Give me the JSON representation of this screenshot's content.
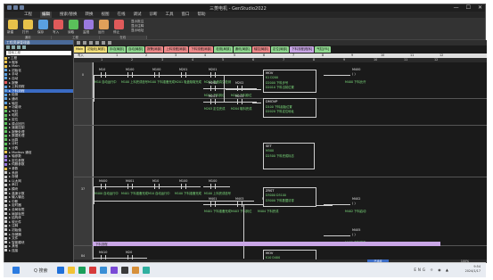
{
  "window": {
    "title": "三菱电机 - GenStudio2022",
    "controls": [
      "—",
      "☐",
      "✕"
    ]
  },
  "menu": {
    "items": [
      "工程",
      "编辑",
      "搜索/替换",
      "转换",
      "视图",
      "在线",
      "调试",
      "诊断",
      "工具",
      "窗口",
      "帮助"
    ],
    "active": 1
  },
  "ribbon": {
    "buttons": [
      {
        "label": "新建",
        "color": "#e8c24a"
      },
      {
        "label": "打开",
        "color": "#e8c24a"
      },
      {
        "label": "保存",
        "color": "#5aa0e0"
      },
      {
        "label": "写入",
        "color": "#e05a5a"
      },
      {
        "label": "读取",
        "color": "#5ac05a"
      },
      {
        "label": "监视",
        "color": "#9a7ae0"
      },
      {
        "label": "运行",
        "color": "#e0a05a"
      },
      {
        "label": "停止",
        "color": "#e05a5a"
      }
    ],
    "side_options": [
      "显示批注",
      "显示注释",
      "显示地址"
    ],
    "groups": [
      "通用",
      "工程",
      "在线"
    ]
  },
  "sidebar": {
    "title": "工程资源管理器",
    "search_placeholder": "搜索工程",
    "items": [
      {
        "label": "▾ 工程",
        "color": "#e8c24a",
        "selected": false
      },
      {
        "label": "  ▾ 程序",
        "color": "#e8c24a",
        "selected": false
      },
      {
        "label": "    ▸ Main",
        "color": "#e8c24a",
        "selected": false
      },
      {
        "label": "    ▸ 初始化",
        "color": "#5aa0e0",
        "selected": false
      },
      {
        "label": "    ▸ 手动",
        "color": "#5aa0e0",
        "selected": false
      },
      {
        "label": "    ▸ 自动",
        "color": "#5aa0e0",
        "selected": false
      },
      {
        "label": "    ▸ 报警",
        "color": "#e05a5a",
        "selected": false
      },
      {
        "label": "    ▸ 上料流程",
        "color": "#5aa0e0",
        "selected": false
      },
      {
        "label": "    ▸ 下料流程",
        "color": "#5aa0e0",
        "selected": true
      },
      {
        "label": "    ▸ 检测",
        "color": "#5aa0e0",
        "selected": false
      },
      {
        "label": "    ▸ 通讯",
        "color": "#5aa0e0",
        "selected": false
      },
      {
        "label": "    ▸ 轴控",
        "color": "#5aa0e0",
        "selected": false
      },
      {
        "label": "  ▾ 功能块",
        "color": "#e8c24a",
        "selected": false
      },
      {
        "label": "    ▸ 气缸",
        "color": "#5ac05a",
        "selected": false
      },
      {
        "label": "    ▸ 电机",
        "color": "#5ac05a",
        "selected": false
      },
      {
        "label": "    ▸ 定位",
        "color": "#5ac05a",
        "selected": false
      },
      {
        "label": "    ▸ 原点回归",
        "color": "#5ac05a",
        "selected": false
      },
      {
        "label": "    ▸ 速度控制",
        "color": "#5ac05a",
        "selected": false
      },
      {
        "label": "    ▸ 报警处理",
        "color": "#5ac05a",
        "selected": false
      },
      {
        "label": "    ▸ 数据处理",
        "color": "#5ac05a",
        "selected": false
      },
      {
        "label": "    ▸ 运算",
        "color": "#5ac05a",
        "selected": false
      },
      {
        "label": "    ▸ 计时",
        "color": "#5ac05a",
        "selected": false
      },
      {
        "label": "    ▸ 计数",
        "color": "#5ac05a",
        "selected": false
      },
      {
        "label": "  ▸ Modbus 通信",
        "color": "#e8c24a",
        "selected": false
      },
      {
        "label": "    ▸ 轴参数",
        "color": "#9a7ae0",
        "selected": false
      },
      {
        "label": "    ▸ 定位参数",
        "color": "#9a7ae0",
        "selected": false
      },
      {
        "label": "    ▸ 伺服参数",
        "color": "#9a7ae0",
        "selected": false
      },
      {
        "label": "  ▾ 参数",
        "color": "#e8c24a",
        "selected": false
      },
      {
        "label": "    ▸ 系统",
        "color": "#cfcfcf",
        "selected": false
      },
      {
        "label": "    ▸ 存储",
        "color": "#cfcfcf",
        "selected": false
      },
      {
        "label": "    ▸ 以太网",
        "color": "#cfcfcf",
        "selected": false
      },
      {
        "label": "    ▸ 串口",
        "color": "#cfcfcf",
        "selected": false
      },
      {
        "label": "    ▸ 模块",
        "color": "#cfcfcf",
        "selected": false
      },
      {
        "label": "    ▸ 高速计数",
        "color": "#cfcfcf",
        "selected": false
      },
      {
        "label": "    ▸ 输入输出",
        "color": "#cfcfcf",
        "selected": false
      },
      {
        "label": "    ▸ 中断",
        "color": "#cfcfcf",
        "selected": false
      },
      {
        "label": "    ▸ 定时器",
        "color": "#cfcfcf",
        "selected": false
      },
      {
        "label": "    ▸ 全局标签",
        "color": "#cfcfcf",
        "selected": false
      },
      {
        "label": "    ▸ 局部标签",
        "color": "#cfcfcf",
        "selected": false
      },
      {
        "label": "    ▸ 结构体",
        "color": "#cfcfcf",
        "selected": false
      },
      {
        "label": "    ▸ 软元件",
        "color": "#cfcfcf",
        "selected": false
      },
      {
        "label": "    ▸ 注释",
        "color": "#cfcfcf",
        "selected": false
      },
      {
        "label": "    ▸ 初始值",
        "color": "#cfcfcf",
        "selected": false
      },
      {
        "label": "    ▸ 存储器",
        "color": "#cfcfcf",
        "selected": false
      },
      {
        "label": "    ▸ 文件",
        "color": "#cfcfcf",
        "selected": false
      },
      {
        "label": "    ▸ 智能模块",
        "color": "#cfcfcf",
        "selected": false
      },
      {
        "label": "    ▸ 其他",
        "color": "#cfcfcf",
        "selected": false
      },
      {
        "label": "    ▸ 连接",
        "color": "#cfcfcf",
        "selected": false
      }
    ]
  },
  "tabs": [
    {
      "label": "Main",
      "color": "#f4e07a"
    },
    {
      "label": "初始化[局部]",
      "color": "#f4e07a"
    },
    {
      "label": "手动[局部]",
      "color": "#8fd88f"
    },
    {
      "label": "自动[局部]",
      "color": "#8fd88f"
    },
    {
      "label": "报警[局部]",
      "color": "#f08a8a"
    },
    {
      "label": "上料流程[局部]",
      "color": "#f08a8a"
    },
    {
      "label": "下料流程[局部]",
      "color": "#f08a8a"
    },
    {
      "label": "检测[局部]",
      "color": "#8fd88f"
    },
    {
      "label": "通讯[局部]",
      "color": "#8fd88f"
    },
    {
      "label": "轴控[局部]",
      "color": "#f08a8a"
    },
    {
      "label": "定位[局部]",
      "color": "#8fd88f"
    },
    {
      "label": "下料流程[程序]",
      "color": "#c9a6e6"
    },
    {
      "label": "气缸[FB]",
      "color": "#8fd88f"
    }
  ],
  "ladder": {
    "header_row1": [
      "写入",
      "1",
      "2",
      "3",
      "4",
      "5",
      "6",
      "7",
      "8",
      "9",
      "10",
      "11",
      "12"
    ],
    "header_row2": [
      "1",
      "2",
      "3",
      "4",
      "5",
      "6",
      "7",
      "8",
      "9",
      "10",
      "11",
      "12"
    ],
    "steps": [
      "0",
      "",
      "",
      "37",
      "",
      "",
      "",
      "84"
    ],
    "contacts": [
      "M10",
      "M100",
      "M100",
      "M201",
      "M201",
      "M202",
      "M202",
      "M203",
      "M204",
      "M400",
      "M401",
      "M10",
      "M100",
      "M100",
      "M401",
      "M403",
      "M404",
      "M410",
      "M20"
    ],
    "contact_labels": [
      "M10 自动运行中",
      "M100 上料完成信号",
      "M100 下料准备完成",
      "M201 吸盘吸取完成",
      "M201 吸盘真空检测",
      "M202 下料到位",
      "M202 下料原位",
      "M203 定位完成",
      "M204 取料完成",
      "M400 自动运行中",
      "M401 下料准备完成",
      "M10 自动运行中",
      "M100 下料准备完成",
      "M100 上料完成信号",
      "M401 下料准备完成",
      "M403 下料到位",
      "M404 下料完成",
      "M410 下料步",
      "M20 下料原位"
    ],
    "fboxes": [
      {
        "title": "MOV",
        "values": [
          "K1 D200",
          "D2000 下料步号",
          "D2010 下料当前位置"
        ]
      },
      {
        "title": "DMOVP",
        "values": [
          "D100 下料起始位置",
          "D2020 下料定位地址"
        ]
      },
      {
        "title": "SET",
        "values": [
          "M500",
          "D2500 下料完成标志"
        ]
      },
      {
        "title": "ZRST",
        "values": [
          "D3000 D3100",
          "D3000 下料数据清零"
        ]
      },
      {
        "title": "MOV",
        "values": [
          "K10 D400",
          "D400 下料计数"
        ]
      }
    ],
    "coils": [
      "M400",
      "M402",
      "M405"
    ],
    "coil_labels": [
      "M400 下料允许",
      "M402 下料启动",
      "M405 下料结束"
    ],
    "comment": "下料流程"
  },
  "statusbar": {
    "state": "已连接",
    "zoom": "100%"
  },
  "taskbar": {
    "search": "Q 搜索",
    "icons": [
      {
        "color": "#1e6fd9"
      },
      {
        "color": "#f2c233"
      },
      {
        "color": "#1a9f5a"
      },
      {
        "color": "#d63a3a"
      },
      {
        "color": "#3a8fd6"
      },
      {
        "color": "#7a4ad6"
      },
      {
        "color": "#3a3a3a"
      },
      {
        "color": "#d6903a"
      },
      {
        "color": "#30b0a0"
      }
    ],
    "tray": "ENG ☼ ◉ ▲",
    "time": "9:54",
    "date": "2024/1/17"
  }
}
